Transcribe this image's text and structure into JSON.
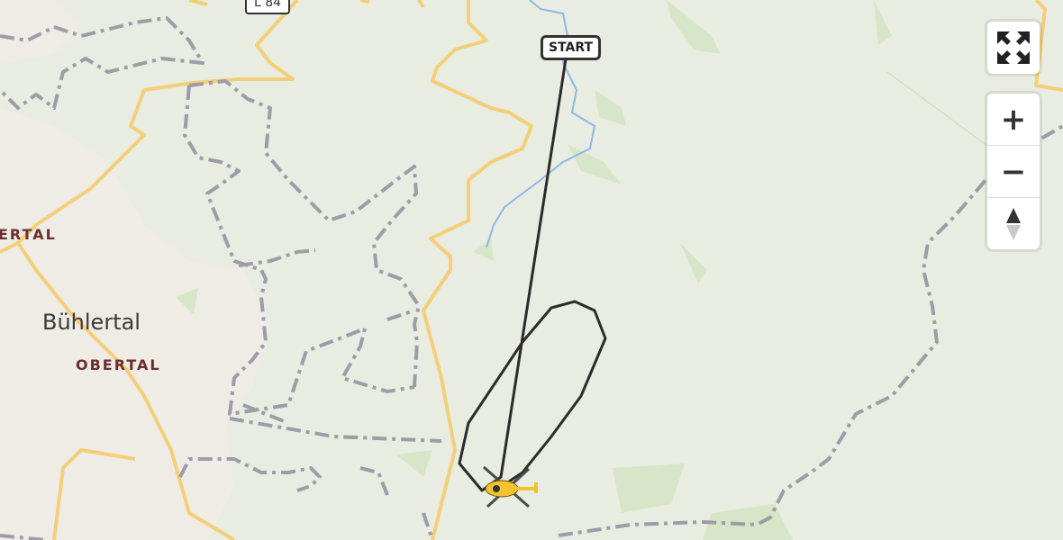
{
  "map": {
    "road_label": "L 84",
    "place_labels": {
      "town": "Bühlertal",
      "district_top": "ERTAL",
      "district_bottom": "OBERTAL"
    },
    "start_marker": "START",
    "colors": {
      "background": "#e9ece0",
      "road": "#f3cf79",
      "track": "#9d9ca8",
      "flight_path": "#2b2b2b",
      "water": "#8bb8e8",
      "helicopter": "#f2c230"
    }
  },
  "controls": {
    "fullscreen_icon": "fullscreen-icon",
    "zoom_in": "+",
    "zoom_out": "−",
    "compass_icon": "compass-icon"
  }
}
